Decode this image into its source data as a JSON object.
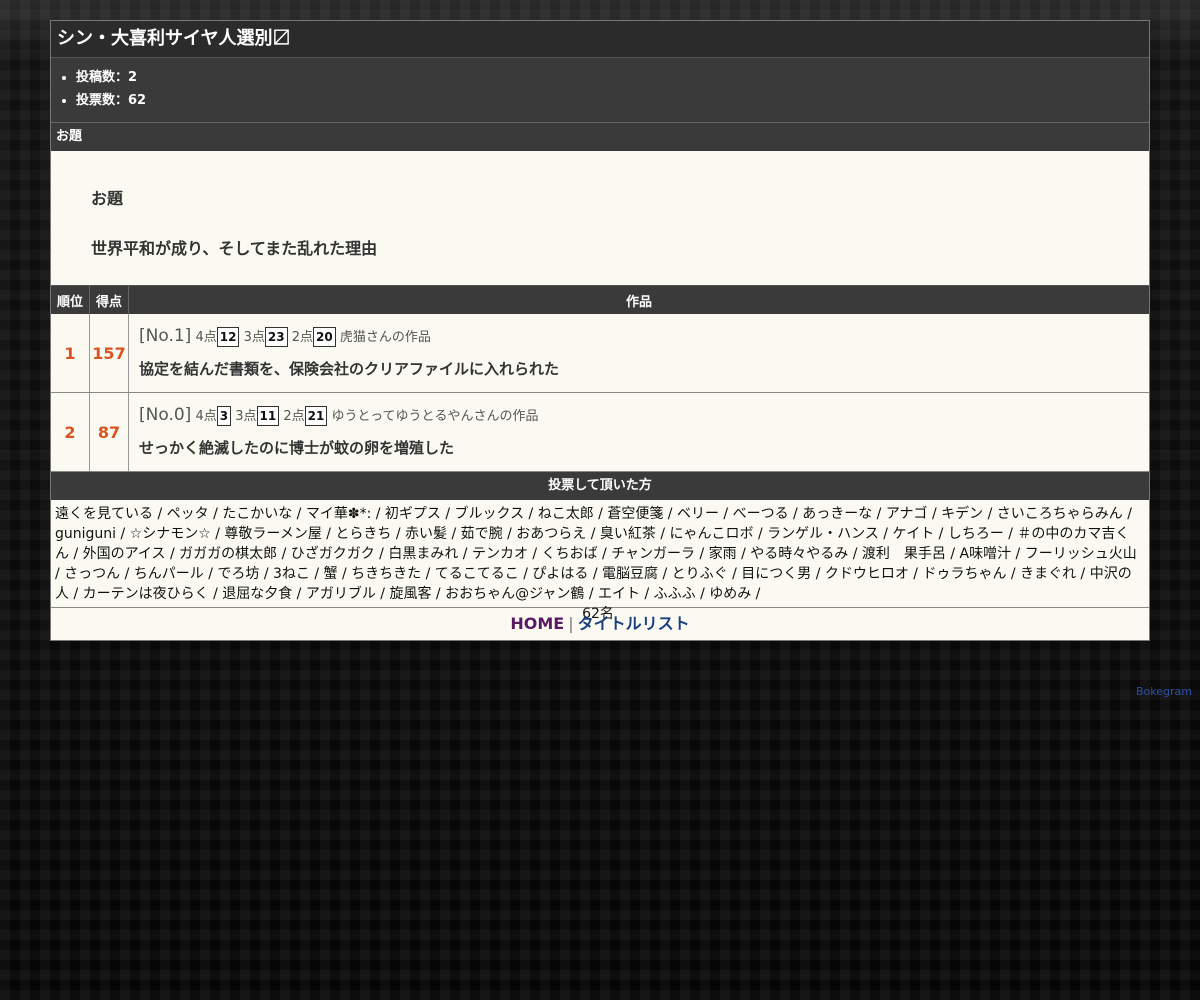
{
  "header": {
    "title": "シン・大喜利サイヤ人選別〼"
  },
  "stats": [
    "投稿数：2",
    "投票数：62"
  ],
  "odai_section": {
    "heading": "お題",
    "label": "お題",
    "text": "世界平和が成り、そしてまた乱れた理由"
  },
  "results": {
    "columns": [
      "順位",
      "得点",
      "作品"
    ],
    "rows": [
      {
        "rank": "1",
        "score": "157",
        "no": "[No.1]",
        "p4_label": "4点",
        "p4": "12",
        "p3_label": "3点",
        "p3": "23",
        "p2_label": "2点",
        "p2": "20",
        "author": "虎猫さんの作品",
        "text": "協定を結んだ書類を、保険会社のクリアファイルに入れられた"
      },
      {
        "rank": "2",
        "score": "87",
        "no": "[No.0]",
        "p4_label": "4点",
        "p4": "3",
        "p3_label": "3点",
        "p3": "11",
        "p2_label": "2点",
        "p2": "21",
        "author": "ゆうとってゆうとるやんさんの作品",
        "text": "せっかく絶滅したのに博士が蚊の卵を増殖した"
      }
    ]
  },
  "voters": {
    "heading": "投票して頂いた方",
    "list": "遠くを見ている / ペッタ / たこかいな / マイ華✽*: / 初ギプス / ブルックス / ねこ太郎 / 蒼空便箋 / ベリー / べーつる / あっきーな / アナゴ / キデン / さいころちゃらみん / guniguni / ☆シナモン☆ / 尊敬ラーメン屋 / とらきち / 赤い髪 / 茹で腕 / おあつらえ / 臭い紅茶 / にゃんこロボ / ランゲル・ハンス / ケイト / しちろー / ＃の中のカマ吉くん / 外国のアイス / ガガガの棋太郎 / ひざガクガク / 白黒まみれ / テンカオ / くちおば / チャンガーラ / 家雨 / やる時々やるみ / 渡利　果手呂 / A味噌汁 / フーリッシュ火山 / さっつん / ちんパール / でろ坊 / 3ねこ / 蟹 / ちきちきた / てるこてるこ / ぴよはる / 電脳豆腐 / とりふぐ / 目につく男 / クドウヒロオ / ドゥラちゃん / きまぐれ / 中沢の人 / カーテンは夜ひらく / 退屈な夕食 / アガリブル / 旋風客 / おおちゃん@ジャン鶴 / エイト / ふふふ / ゆめみ /",
    "count": "62名"
  },
  "footer": {
    "home": "HOME",
    "separator": "|",
    "title_list": "タイトルリスト"
  },
  "credit": "Bokegram"
}
